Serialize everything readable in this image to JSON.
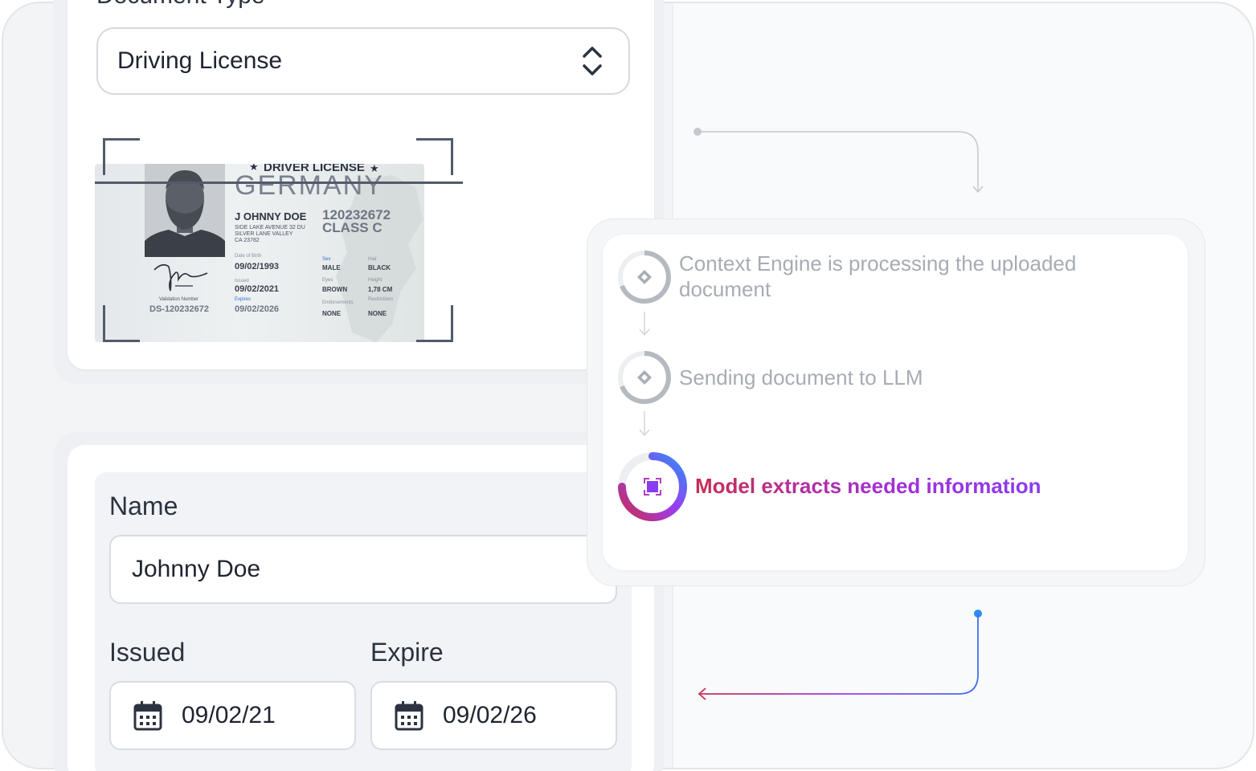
{
  "document_type": {
    "label": "Document Type",
    "selected": "Driving License"
  },
  "license": {
    "header": "DRIVER LICENSE",
    "country": "GERMANY",
    "holder_name": "J OHNNY DOE",
    "number": "120232672",
    "class": "CLASS C",
    "address_line1": "SIDE LAKE AVENUE 32 DU",
    "address_line2": "SILVER LANE VALLEY",
    "address_line3": "CA 23782",
    "dob_label": "Date of Birth",
    "dob": "09/02/1993",
    "issued_label": "Issued",
    "issued": "09/02/2021",
    "expires_label": "Expires",
    "expires": "09/02/2026",
    "sex_label": "Sex",
    "sex": "MALE",
    "hair_label": "Hair",
    "hair": "BLACK",
    "eyes_label": "Eyes",
    "eyes": "BROWN",
    "height_label": "Height",
    "height": "1,78 CM",
    "endorsements_label": "Endorsements",
    "endorsements": "NONE",
    "restrictions_label": "Restrictions",
    "restrictions": "NONE",
    "validation_label": "Validation Number",
    "validation_number": "DS-120232672"
  },
  "form": {
    "name_label": "Name",
    "name_value": "Johnny Doe",
    "issued_label": "Issued",
    "issued_value": "09/02/21",
    "expire_label": "Expire",
    "expire_value": "09/02/26"
  },
  "process": {
    "steps": [
      {
        "line1": "Context Engine is processing the uploaded",
        "line2": "document",
        "state": "done"
      },
      {
        "line1": "Sending document to LLM",
        "state": "done"
      },
      {
        "line1": "Model extracts needed information",
        "state": "active"
      }
    ]
  },
  "colors": {
    "accent_red": "#c62f52",
    "accent_purple": "#9b3cf0",
    "accent_blue": "#2f8df5",
    "muted": "#a7acb4"
  }
}
